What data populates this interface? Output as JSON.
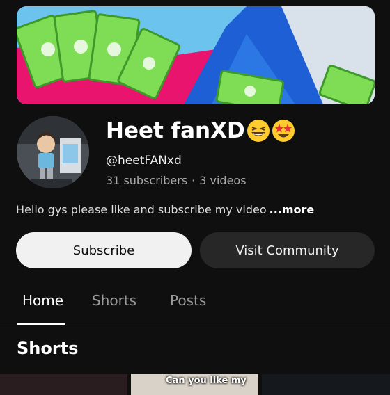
{
  "channel": {
    "name": "Heet fanXD",
    "name_emojis": [
      "grinning-squinting-face-emoji",
      "star-struck-face-emoji"
    ],
    "handle": "@heetFANxd",
    "subscribers": "31 subscribers",
    "separator": "·",
    "videos": "3 videos",
    "description": "Hello gys please like and subscribe my video",
    "more_label": "...more"
  },
  "actions": {
    "subscribe_label": "Subscribe",
    "community_label": "Visit Community"
  },
  "tabs": [
    {
      "label": "Home",
      "active": true
    },
    {
      "label": "Shorts",
      "active": false
    },
    {
      "label": "Posts",
      "active": false
    }
  ],
  "shorts_section": {
    "title": "Shorts",
    "thumbnails": [
      {
        "caption": ""
      },
      {
        "caption": "Can you like my"
      },
      {
        "caption": ""
      }
    ]
  },
  "colors": {
    "background": "#0f0f0f",
    "subscribe_bg": "#f1f1f1",
    "community_bg": "#272727"
  }
}
